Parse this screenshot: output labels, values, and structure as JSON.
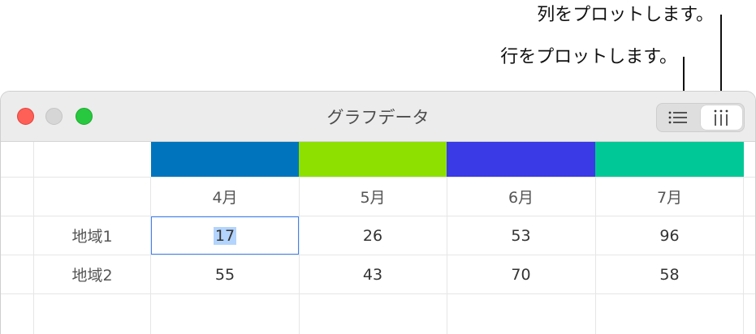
{
  "callouts": {
    "plot_columns": "列をプロットします。",
    "plot_rows": "行をプロットします。"
  },
  "window": {
    "title": "グラフデータ"
  },
  "toolbar": {
    "plot_rows_icon": "list-rows-icon",
    "plot_columns_icon": "columns-icon",
    "active": "columns"
  },
  "table": {
    "column_colors": [
      "#0075be",
      "#8ee000",
      "#3a3ae6",
      "#00c896"
    ],
    "columns": [
      "4月",
      "5月",
      "6月",
      "7月"
    ],
    "rows": [
      {
        "label": "地域1",
        "values": [
          "17",
          "26",
          "53",
          "96"
        ]
      },
      {
        "label": "地域2",
        "values": [
          "55",
          "43",
          "70",
          "58"
        ]
      }
    ],
    "selected_cell": {
      "row": 0,
      "column": 0
    }
  }
}
